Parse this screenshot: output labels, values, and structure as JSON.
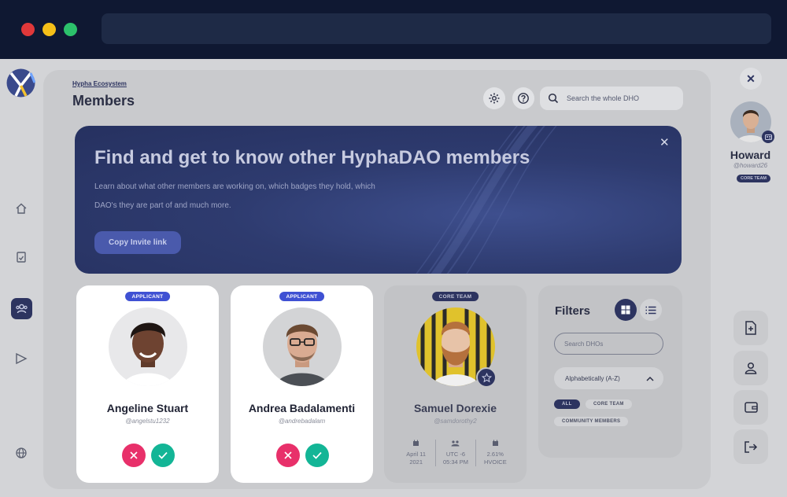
{
  "browser": {
    "window_controls": [
      "close-dot",
      "minimize-dot",
      "maximize-dot"
    ]
  },
  "header": {
    "breadcrumb": "Hypha Ecosystem",
    "title": "Members",
    "search_placeholder": "Search the whole DHO"
  },
  "banner": {
    "title": "Find and get to know other HyphaDAO members",
    "description_line1": "Learn about what other members are working on, which badges they hold, which",
    "description_line2": "DAO's they are part of and much more.",
    "button_label": "Copy Invite link",
    "close_glyph": "✕"
  },
  "nav": {
    "items": [
      "home-icon",
      "proposals-icon",
      "members-icon",
      "explore-icon",
      "globe-icon"
    ],
    "active": "members-icon"
  },
  "members": [
    {
      "badge": "APPLICANT",
      "name": "Angeline Stuart",
      "handle": "@angelstu1232",
      "avatar_colors": {
        "skin": "#6e4331",
        "hair": "#1f1613",
        "shirt": "#ffffff",
        "bg": "#e8e8ea"
      }
    },
    {
      "badge": "APPLICANT",
      "name": "Andrea Badalamenti",
      "handle": "@andrebadalam",
      "avatar_colors": {
        "skin": "#d9ab92",
        "hair": "#6b4a33",
        "shirt": "#4b4f55",
        "bg": "#d3d4d6"
      }
    },
    {
      "badge": "CORE TEAM",
      "name": "Samuel Dorexie",
      "handle": "@samdorothy2",
      "avatar_colors": {
        "skin": "#e7c3a8",
        "hair": "#b5713d",
        "shirt": "#f0f0f0",
        "bg": "#e0c22c"
      },
      "stats": [
        {
          "line1": "April 11",
          "line2": "2021",
          "icon": "calendar-icon"
        },
        {
          "line1": "UTC -6",
          "line2": "05:34 PM",
          "icon": "timezone-icon"
        },
        {
          "line1": "2.61%",
          "line2": "HVOICE",
          "icon": "voice-icon"
        }
      ]
    }
  ],
  "filters": {
    "title": "Filters",
    "search_placeholder": "Search DHOs",
    "sort_label": "Alphabetically (A-Z)",
    "chips": [
      "ALL",
      "CORE TEAM",
      "COMMUNITY MEMBERS"
    ],
    "active_chip": "ALL",
    "view": "grid"
  },
  "profile": {
    "name": "Howard",
    "handle": "@howard26",
    "badge": "CORE TEAM",
    "close_glyph": "✕"
  },
  "sidebar_actions": [
    "new-document-icon",
    "profile-icon",
    "wallet-icon",
    "logout-icon"
  ],
  "colors": {
    "accent": "#3f51d3",
    "navy": "#2d3460",
    "reject": "#e8306a",
    "accept": "#13b596"
  }
}
